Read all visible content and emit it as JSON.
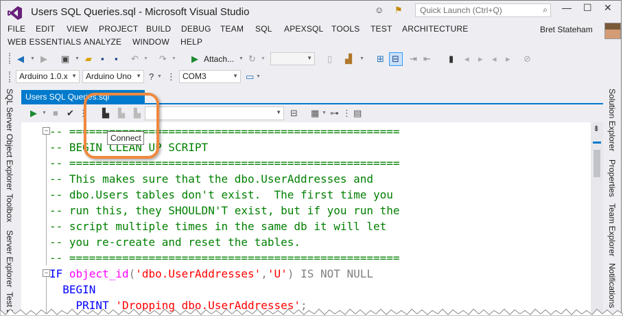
{
  "window": {
    "title": "Users SQL Queries.sql  - Microsoft Visual Studio",
    "quick_launch_placeholder": "Quick Launch (Ctrl+Q)",
    "user_name": "Bret Stateham"
  },
  "menu": {
    "row1": [
      "FILE",
      "EDIT",
      "VIEW",
      "PROJECT",
      "BUILD",
      "DEBUG",
      "TEAM",
      "SQL",
      "APEXSQL",
      "TOOLS",
      "TEST",
      "ARCHITECTURE"
    ],
    "row2": [
      "WEB ESSENTIALS",
      "ANALYZE",
      "WINDOW",
      "HELP"
    ]
  },
  "toolbar": {
    "attach_label": "Attach...",
    "board_combo": "Arduino 1.0.x",
    "model_combo": "Arduino Uno",
    "port_combo": "COM3"
  },
  "left_tool_tabs": [
    "SQL Server Object Explorer",
    "Toolbox",
    "Server Explorer",
    "Test E"
  ],
  "right_tool_tabs": [
    "Solution Explorer",
    "Properties",
    "Team Explorer",
    "Notifications"
  ],
  "document_tab": {
    "title": "Users SQL Queries.sql"
  },
  "tooltip": {
    "text": "Connect"
  },
  "code_lines": [
    {
      "parts": [
        {
          "t": "-- ==================================================",
          "c": "cm"
        }
      ]
    },
    {
      "parts": [
        {
          "t": "-- BEGIN CLEAN UP SCRIPT",
          "c": "cm"
        }
      ]
    },
    {
      "parts": [
        {
          "t": "-- ==================================================",
          "c": "cm"
        }
      ]
    },
    {
      "parts": [
        {
          "t": "-- This makes sure that the dbo.UserAddresses and",
          "c": "cm"
        }
      ]
    },
    {
      "parts": [
        {
          "t": "-- dbo.Users tables don't exist.  The first time you",
          "c": "cm"
        }
      ]
    },
    {
      "parts": [
        {
          "t": "-- run this, they SHOULDN'T exist, but if you run the",
          "c": "cm"
        }
      ]
    },
    {
      "parts": [
        {
          "t": "-- script multiple times in the same db it will let",
          "c": "cm"
        }
      ]
    },
    {
      "parts": [
        {
          "t": "-- you re-create and reset the tables.",
          "c": "cm"
        }
      ]
    },
    {
      "parts": [
        {
          "t": "-- ==================================================",
          "c": "cm"
        }
      ]
    },
    {
      "parts": [
        {
          "t": "IF ",
          "c": "kw"
        },
        {
          "t": "object_id",
          "c": "fn"
        },
        {
          "t": "(",
          "c": "gr"
        },
        {
          "t": "'dbo.UserAddresses'",
          "c": "st"
        },
        {
          "t": ",",
          "c": "gr"
        },
        {
          "t": "'U'",
          "c": "st"
        },
        {
          "t": ") IS NOT NULL",
          "c": "gr"
        }
      ]
    },
    {
      "parts": [
        {
          "t": "  BEGIN",
          "c": "kw"
        }
      ]
    },
    {
      "parts": [
        {
          "t": "    PRINT ",
          "c": "kw"
        },
        {
          "t": "'Dropping dbo.UserAddresses'",
          "c": "st"
        },
        {
          "t": ";",
          "c": "gr"
        }
      ]
    }
  ],
  "colors": {
    "accent": "#007acc",
    "callout": "#f0883e",
    "comment": "#008000",
    "keyword": "#0000ff",
    "function": "#ff00ff",
    "string": "#ff0000"
  }
}
